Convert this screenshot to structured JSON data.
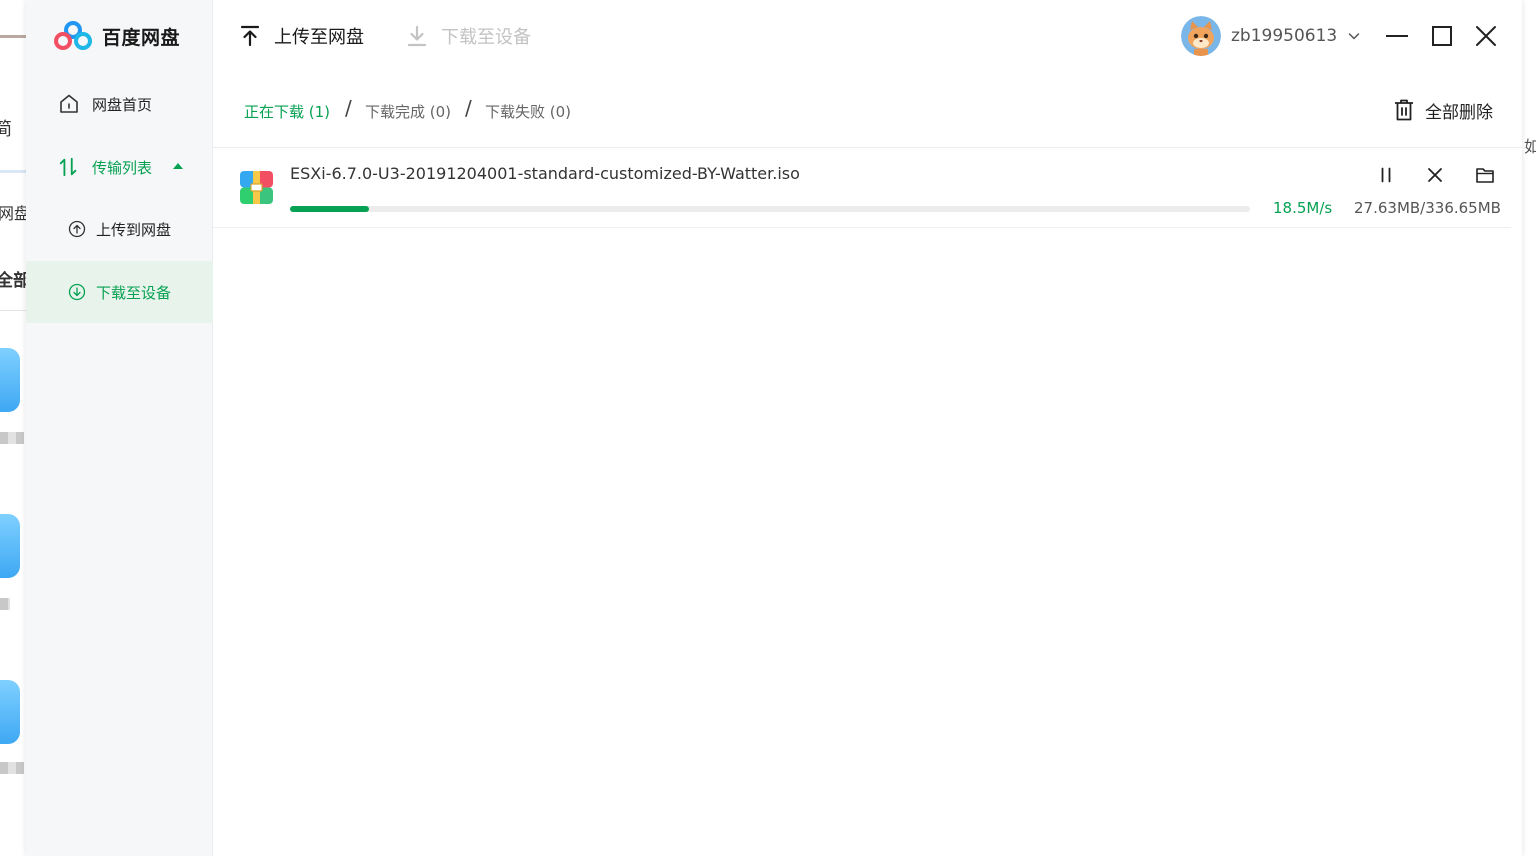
{
  "background": {
    "left_texts": [
      "简",
      "网盘",
      "全部"
    ],
    "right_text": "如"
  },
  "app": {
    "name": "百度网盘"
  },
  "sidebar": {
    "items": [
      {
        "label": "网盘首页",
        "icon": "home-icon"
      },
      {
        "label": "传输列表",
        "icon": "transfer-icon",
        "expanded": true
      },
      {
        "label": "上传到网盘",
        "icon": "upload-circle-icon"
      },
      {
        "label": "下载至设备",
        "icon": "download-circle-icon",
        "selected": true
      }
    ]
  },
  "header": {
    "upload_label": "上传至网盘",
    "download_label": "下载至设备",
    "username": "zb19950613"
  },
  "tabs": {
    "downloading": "正在下载 (1)",
    "completed": "下载完成 (0)",
    "failed": "下载失败 (0)",
    "separator": "/",
    "delete_all": "全部删除"
  },
  "downloads": [
    {
      "filename": "ESXi-6.7.0-U3-20191204001-standard-customized-BY-Watter.iso",
      "speed": "18.5M/s",
      "size": "27.63MB/336.65MB",
      "progress_fraction": 0.082
    }
  ],
  "colors": {
    "accent": "#06a152",
    "selected_bg": "#e8f3ec",
    "sidebar_bg": "#f6f7f9",
    "disabled_text": "#c3c3c3"
  }
}
